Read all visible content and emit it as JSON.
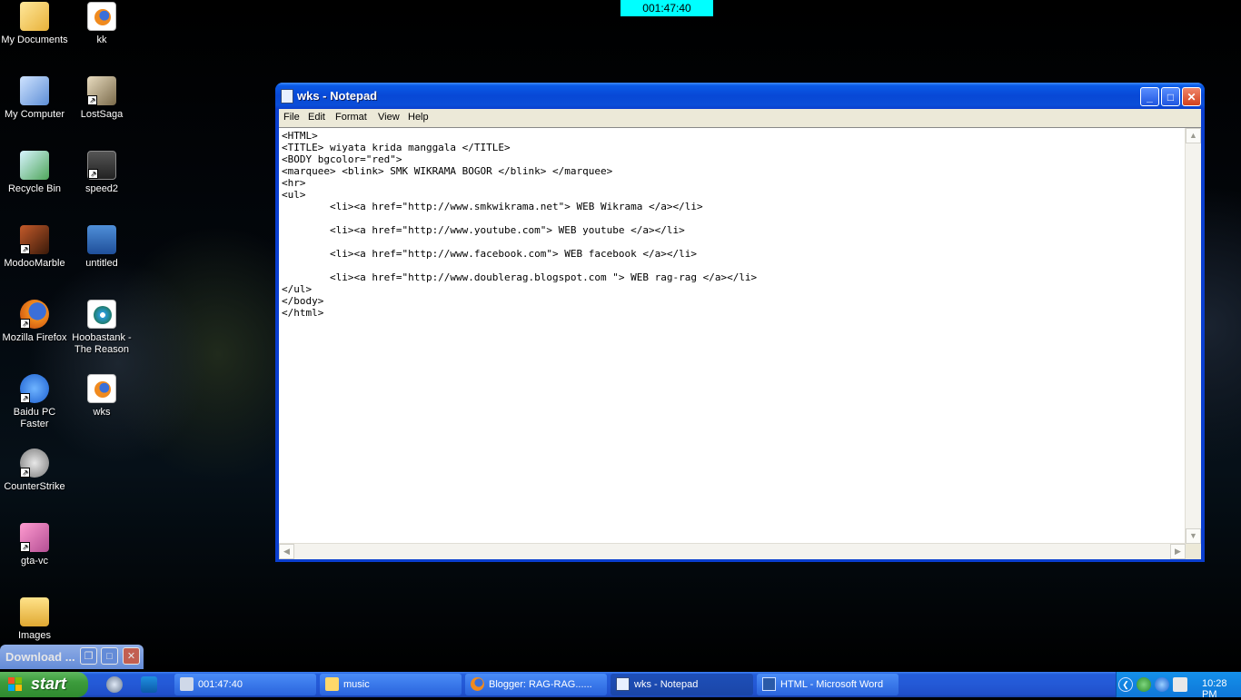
{
  "top_timer": "001:47:40",
  "desktop_icons": [
    {
      "label": "My Documents",
      "icon": "my-documents-icon"
    },
    {
      "label": "kk",
      "icon": "firefox-html-icon"
    },
    {
      "label": "My Computer",
      "icon": "my-computer-icon"
    },
    {
      "label": "LostSaga",
      "icon": "lostsaga-icon"
    },
    {
      "label": "Recycle Bin",
      "icon": "recycle-bin-icon"
    },
    {
      "label": "speed2",
      "icon": "nfs-icon"
    },
    {
      "label": "ModooMarble",
      "icon": "modoomarble-icon"
    },
    {
      "label": "untitled",
      "icon": "psd-icon"
    },
    {
      "label": "Mozilla Firefox",
      "icon": "firefox-icon"
    },
    {
      "label": "Hoobastank - The Reason",
      "icon": "media-player-icon"
    },
    {
      "label": "Baidu PC Faster",
      "icon": "baidu-icon"
    },
    {
      "label": "wks",
      "icon": "firefox-html-icon"
    },
    {
      "label": "CounterStrike",
      "icon": "counterstrike-icon"
    },
    {
      "label": "gta-vc",
      "icon": "gta-icon"
    },
    {
      "label": "Images",
      "icon": "folder-icon"
    }
  ],
  "notepad": {
    "title": "wks - Notepad",
    "menu": [
      "File",
      "Edit",
      "Format",
      "View",
      "Help"
    ],
    "content": "<HTML>\n<TITLE> wiyata krida manggala </TITLE>\n<BODY bgcolor=\"red\">\n<marquee> <blink> SMK WIKRAMA BOGOR </blink> </marquee>\n<hr>\n<ul>\n        <li><a href=\"http://www.smkwikrama.net\"> WEB Wikrama </a></li>\n\n        <li><a href=\"http://www.youtube.com\"> WEB youtube </a></li>\n\n        <li><a href=\"http://www.facebook.com\"> WEB facebook </a></li>\n\n        <li><a href=\"http://www.doublerag.blogspot.com \"> WEB rag-rag </a></li>\n</ul>\n</body>\n</html>"
  },
  "download_window": {
    "title": "Download ..."
  },
  "taskbar": {
    "start_label": "start",
    "tasks": [
      {
        "label": "001:47:40",
        "icon": "timer-app-icon"
      },
      {
        "label": "music",
        "icon": "folder-icon"
      },
      {
        "label": "Blogger: RAG-RAG......",
        "icon": "firefox-icon"
      },
      {
        "label": "wks - Notepad",
        "icon": "notepad-icon"
      },
      {
        "label": "HTML - Microsoft Word",
        "icon": "word-icon"
      }
    ],
    "clock": "10:28 PM"
  },
  "colors": {
    "taskbar": "#245edb",
    "start": "#3c9c3c",
    "timer_bg": "#00ffff",
    "titlebar": "#0848d6"
  }
}
